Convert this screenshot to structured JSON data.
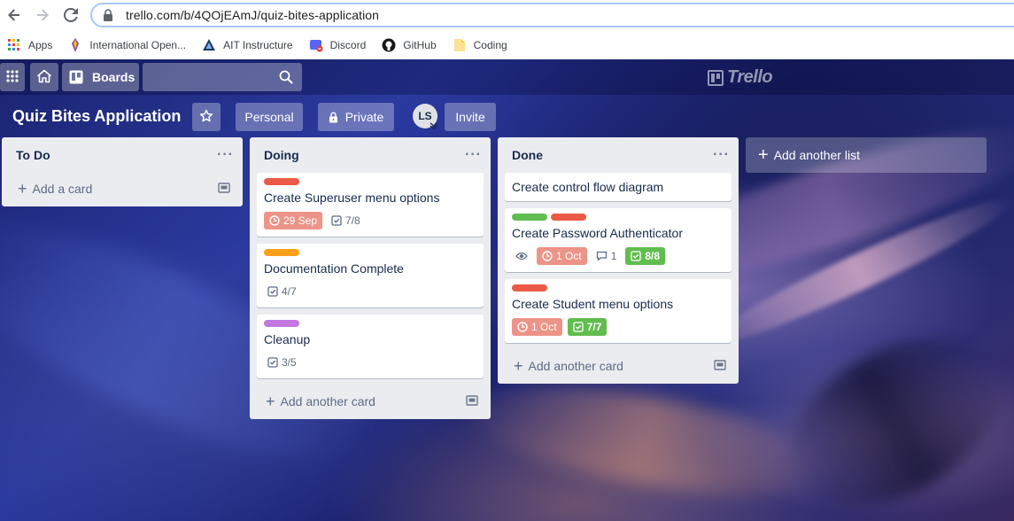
{
  "browser": {
    "url": "trello.com/b/4QOjEAmJ/quiz-bites-application",
    "bookmarks": [
      {
        "label": "Apps",
        "icon": "apps-grid-icon"
      },
      {
        "label": "International Open...",
        "icon": "bookmark-favicon-icon"
      },
      {
        "label": "AIT Instructure",
        "icon": "instructure-icon"
      },
      {
        "label": "Discord",
        "icon": "discord-icon"
      },
      {
        "label": "GitHub",
        "icon": "github-icon"
      },
      {
        "label": "Coding",
        "icon": "folder-icon"
      }
    ]
  },
  "header": {
    "boards_label": "Boards",
    "logo_text": "Trello"
  },
  "board": {
    "title": "Quiz Bites Application",
    "team_label": "Personal",
    "visibility_label": "Private",
    "member_initials": "LS",
    "invite_label": "Invite"
  },
  "lists": [
    {
      "title": "To Do",
      "add_label": "Add a card",
      "cards": []
    },
    {
      "title": "Doing",
      "add_label": "Add another card",
      "cards": [
        {
          "title": "Create Superuser menu options",
          "labels": [
            "#eb5a46"
          ],
          "due": "29 Sep",
          "checklist": "7/8"
        },
        {
          "title": "Documentation Complete",
          "labels": [
            "#ff9f1a"
          ],
          "checklist": "4/7"
        },
        {
          "title": "Cleanup",
          "labels": [
            "#c377e0"
          ],
          "checklist": "3/5"
        }
      ]
    },
    {
      "title": "Done",
      "add_label": "Add another card",
      "cards": [
        {
          "title": "Create control flow diagram",
          "labels": []
        },
        {
          "title": "Create Password Authenticator",
          "labels": [
            "#61bd4f",
            "#eb5a46"
          ],
          "watch": true,
          "due": "1 Oct",
          "comments": "1",
          "checklist": "8/8"
        },
        {
          "title": "Create Student menu options",
          "labels": [
            "#eb5a46"
          ],
          "due": "1 Oct",
          "checklist": "7/7"
        }
      ]
    }
  ],
  "add_list_label": "Add another list",
  "colors": {
    "due_overdue": "#ec9488",
    "checklist_complete": "#61bd4f",
    "list_bg": "#ebecf0"
  }
}
